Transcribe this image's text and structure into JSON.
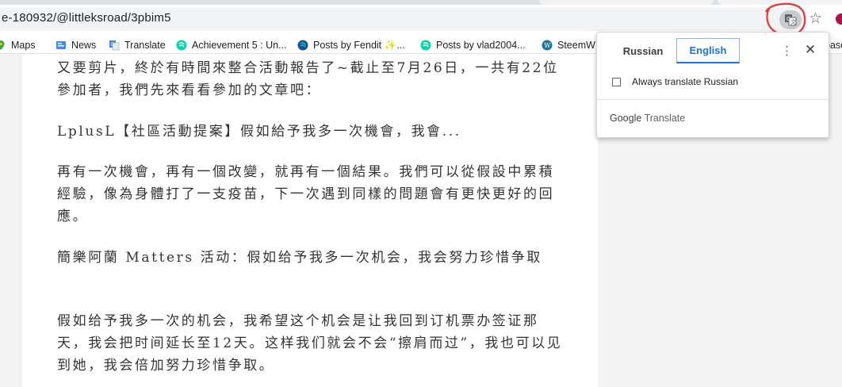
{
  "browser": {
    "url": "e-180932/@littleksroad/3pbim5",
    "bookmarks": [
      {
        "label": "Maps",
        "icon": "google-maps-icon"
      },
      {
        "label": "News",
        "icon": "google-news-icon"
      },
      {
        "label": "Translate",
        "icon": "google-translate-icon"
      },
      {
        "label": "Achievement 5 : Un...",
        "icon": "steemit-icon"
      },
      {
        "label": "Posts by Fendit ✨...",
        "icon": "steemit-icon"
      },
      {
        "label": "Posts by vlad2004...",
        "icon": "steemit-icon"
      },
      {
        "label": "SteemW",
        "icon": "wordpress-icon"
      }
    ],
    "bookmark_overflow": "base",
    "colors": {
      "accent": "#1a73e8",
      "annotation": "#e53935",
      "profile": "#b0124a"
    }
  },
  "article": {
    "paragraphs": [
      "又要剪片，終於有時間來整合活動報告了~截止至7月26日，一共有22位參加者，我們先來看看參加的文章吧：",
      "LplusL【社區活動提案】假如給予我多一次機會，我會...",
      "再有一次機會，再有一個改變，就再有一個結果。我們可以從假設中累積經驗，像為身體打了一支疫苗，下一次遇到同樣的問題會有更快更好的回應。",
      "簡樂阿蘭 Matters 活动：假如给予我多一次机会，我会努力珍惜争取",
      "假如给予我多一次的机会，我希望这个机会是让我回到订机票办签证那天，我会把时间延长至12天。这样我们就会不会“擦肩而过”，我也可以见到她，我会倍加努力珍惜争取。"
    ]
  },
  "translate_popup": {
    "tab_source": "Russian",
    "tab_target": "English",
    "checkbox_label": "Always translate Russian",
    "checkbox_checked": false,
    "footer_brand": "Google",
    "footer_product": "Translate"
  }
}
